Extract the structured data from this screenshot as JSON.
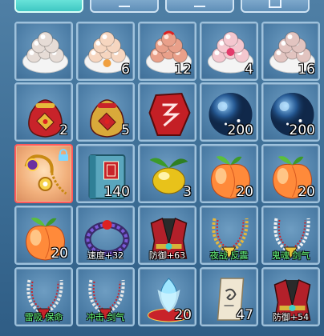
{
  "tabs": [
    {
      "label": "",
      "icon": "tab-active-icon"
    },
    {
      "label": "",
      "icon": "minus-icon"
    },
    {
      "label": "",
      "icon": "minus-icon"
    },
    {
      "label": "",
      "icon": "box-icon"
    }
  ],
  "slots": [
    {
      "item": "glutinous-rice-balls-plate",
      "count": "",
      "stat": ""
    },
    {
      "item": "peach-buns-plate",
      "count": "6",
      "stat": ""
    },
    {
      "item": "red-bean-buns-plate",
      "count": "12",
      "stat": ""
    },
    {
      "item": "pink-dumplings-plate",
      "count": "4",
      "stat": ""
    },
    {
      "item": "sesame-balls-plate",
      "count": "16",
      "stat": ""
    },
    {
      "item": "red-lucky-bag",
      "count": "2",
      "stat": ""
    },
    {
      "item": "gold-lucky-bag",
      "count": "5",
      "stat": ""
    },
    {
      "item": "red-rune-stone",
      "count": "",
      "stat": ""
    },
    {
      "item": "blue-star-orb",
      "count": "200",
      "stat": ""
    },
    {
      "item": "blue-star-orb",
      "count": "200",
      "stat": ""
    },
    {
      "item": "gold-amulet",
      "count": "",
      "stat": "",
      "locked": true,
      "selected": true
    },
    {
      "item": "blue-book",
      "count": "140",
      "stat": ""
    },
    {
      "item": "golden-fruit",
      "count": "3",
      "stat": ""
    },
    {
      "item": "immortal-peach",
      "count": "20",
      "stat": ""
    },
    {
      "item": "immortal-peach",
      "count": "20",
      "stat": ""
    },
    {
      "item": "immortal-peach",
      "count": "20",
      "stat": ""
    },
    {
      "item": "beaded-bracelet",
      "count": "",
      "stat_a": "速度",
      "stat_b": "+32"
    },
    {
      "item": "red-armor",
      "count": "",
      "stat_a": "防御",
      "stat_b": "+63"
    },
    {
      "item": "gold-necklace",
      "count": "",
      "stat_a": "夜战",
      "stat_b": " 反震"
    },
    {
      "item": "pearl-necklace",
      "count": "",
      "stat_a": "鬼魂",
      "stat_b": " 剑气"
    },
    {
      "item": "silver-necklace",
      "count": "",
      "stat_a": "雷吸",
      "stat_b": " 保命"
    },
    {
      "item": "silver-necklace",
      "count": "",
      "stat_a": "冲击",
      "stat_b": " 剑气"
    },
    {
      "item": "crystal-lotus",
      "count": "20",
      "stat": ""
    },
    {
      "item": "paper-scroll",
      "count": "47",
      "stat": ""
    },
    {
      "item": "red-armor",
      "count": "",
      "stat_a": "防御",
      "stat_b": "+54"
    }
  ],
  "colors": {
    "panel_bg": "#3a6b93",
    "slot_border": "#9ec2dd",
    "selected_border": "#ff5a5a",
    "stat_green": "#68ff7a",
    "count_white": "#ffffff"
  }
}
